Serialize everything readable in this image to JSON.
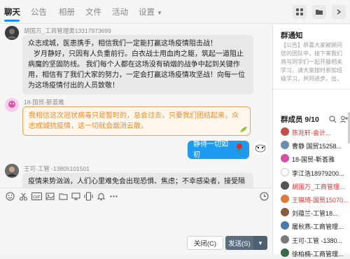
{
  "tabs": [
    {
      "label": "聊天",
      "active": true
    },
    {
      "label": "公告"
    },
    {
      "label": "相册"
    },
    {
      "label": "文件"
    },
    {
      "label": "活动"
    },
    {
      "label": "设置"
    }
  ],
  "colors": {
    "accent": "#1e90ff",
    "orange": "#ee8a2a",
    "red_name": "#e03030",
    "send": "#5a6e7f"
  },
  "messages": [
    {
      "sender": "胡国万_工商管理类13317973699",
      "paragraphs": [
        "众志成城，医患携手，相信我们一定能打赢这场疫情阻击战！",
        "岁月静好，只因有人负重前行。白衣战士用血肉之躯，筑起一道阻止病魔的坚固防线。        我们每个人都在这场没有硝烟的战争中起到关键作用，相信有了我们大家的努力，一定会打赢这场疫情攻坚战！向每一位为这场疫情付出的人员致敬！"
      ]
    },
    {
      "sender": "18-国贸-靳荟雅",
      "text": "我相信这次冠状病毒只是暂时的，总会过去，只要我们团结起来，众志成城抗疫情，这一切就会烟消云散。"
    },
    {
      "text": "静待一切如初"
    },
    {
      "sender": "王可-工管 -13805101501",
      "text": "疫情来势汹汹，人们心里难免会出现恐惧、焦虑；不幸感染者，接受隔离治疗，"
    }
  ],
  "toolbar_icons": [
    "emoji-icon",
    "scissors-icon",
    "gif-icon",
    "image-icon",
    "folder-icon",
    "screen-icon",
    "shake-icon",
    "bell-icon",
    "more-icon",
    "clock-icon"
  ],
  "buttons": {
    "close": "关闭(C)",
    "send": "发送(S)"
  },
  "panel": {
    "notice_title": "群通知",
    "notice_text": "【公告】恭喜大家被顾问您的团队中，接下来我们将与同学们一起开展相关学习，请大家按时参加班级学习，共同进步。出，来到经管团学办公室的团队中，接下来与同学们一起学习……",
    "members_title": "群成员 9/10",
    "members": [
      {
        "name": "陈兆轩-会计...",
        "red": true,
        "color": "#c94b4b"
      },
      {
        "name": "曹静 国贸15258...",
        "red": false,
        "color": "#6a8caf"
      },
      {
        "name": "18-国贸-靳荟雅",
        "red": false,
        "color": "#d44ea8"
      },
      {
        "name": "李江浩18979200...",
        "red": false,
        "color": "#ffffff"
      },
      {
        "name": "胡国万_工商管理...",
        "red": true,
        "color": "#555555"
      },
      {
        "name": "王锦琦-国贸15070...",
        "red": true,
        "color": "#e07a3a"
      },
      {
        "name": "刘蕴兰-工管18...",
        "red": false,
        "color": "#8a5a3a"
      },
      {
        "name": "屠秋燕-工商管理...",
        "red": false,
        "color": "#4a7ab0"
      },
      {
        "name": "王可-工管 -1380...",
        "red": false,
        "color": "#7a7a7a"
      },
      {
        "name": "徐柏楠-工商管理...",
        "red": false,
        "color": "#3a6a4a"
      }
    ]
  }
}
